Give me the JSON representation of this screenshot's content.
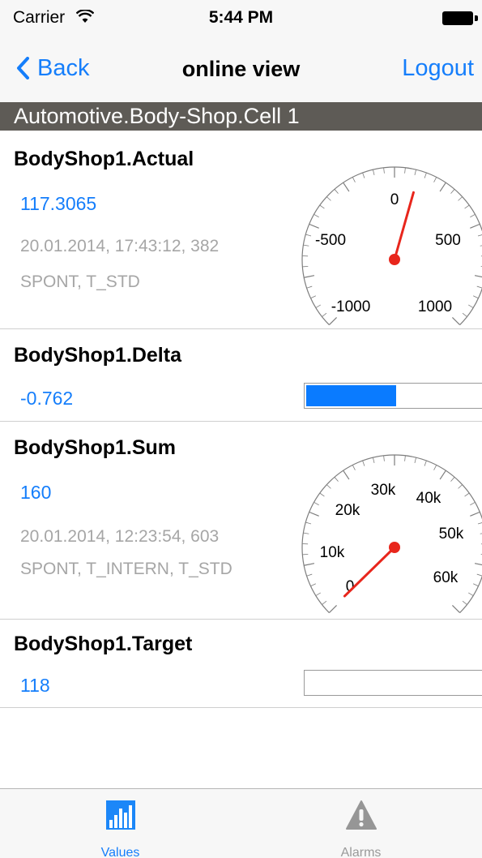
{
  "status_bar": {
    "carrier": "Carrier",
    "time": "5:44 PM"
  },
  "nav": {
    "back_label": "Back",
    "title": "online view",
    "logout_label": "Logout"
  },
  "section": {
    "title": "Automotive.Body-Shop.Cell 1"
  },
  "items": [
    {
      "title": "BodyShop1.Actual",
      "value": "117.3065",
      "timestamp": "20.01.2014, 17:43:12, 382",
      "flags": "SPONT, T_STD",
      "gauge": {
        "min": -1000,
        "max": 1000,
        "value": 117.3065,
        "labels": [
          "-1000",
          "-500",
          "0",
          "500",
          "1000"
        ]
      }
    },
    {
      "title": "BodyShop1.Delta",
      "value": "-0.762",
      "bar_fill_fraction": 0.5
    },
    {
      "title": "BodyShop1.Sum",
      "value": "160",
      "timestamp": "20.01.2014, 12:23:54, 603",
      "flags": "SPONT, T_INTERN, T_STD",
      "gauge": {
        "min": 0,
        "max": 60000,
        "value": 160,
        "labels": [
          "0",
          "10k",
          "20k",
          "30k",
          "40k",
          "50k",
          "60k"
        ]
      }
    },
    {
      "title": "BodyShop1.Target",
      "value": "118",
      "bar_fill_fraction": 0
    }
  ],
  "tabs": [
    {
      "label": "Values",
      "icon": "bar-chart-icon",
      "active": true
    },
    {
      "label": "Alarms",
      "icon": "warning-icon",
      "active": false
    }
  ],
  "colors": {
    "accent": "#157efb",
    "needle": "#e8261c",
    "section_header": "#5e5b56",
    "meta_text": "#a6a6a6",
    "bar_fill": "#0a7bff"
  }
}
